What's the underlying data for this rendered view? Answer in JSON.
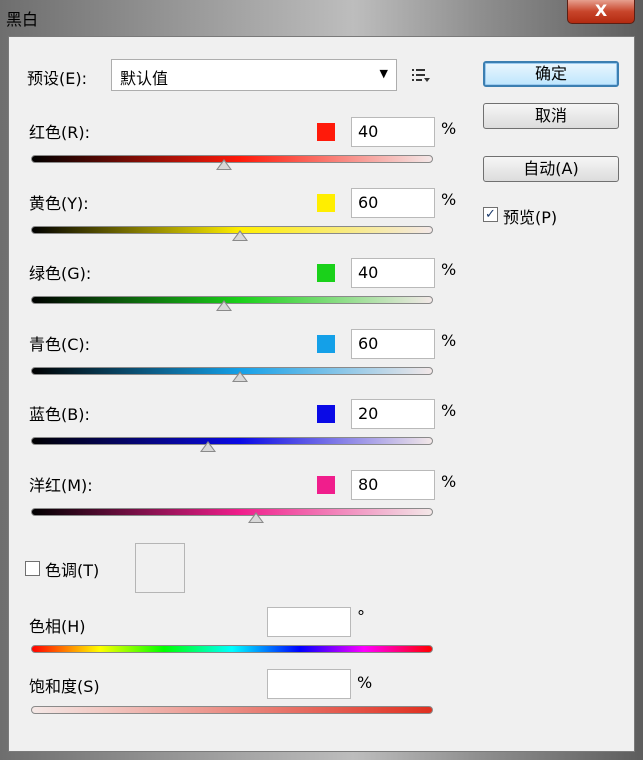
{
  "window": {
    "title": "黑白",
    "close_label": "X"
  },
  "preset": {
    "label": "预设(E):",
    "value": "默认值",
    "arrow": "▼",
    "menu_icon": "list-menu-icon"
  },
  "buttons": {
    "ok": "确定",
    "cancel": "取消",
    "auto": "自动(A)"
  },
  "preview": {
    "label": "预览(P)",
    "checked": true,
    "check_mark": "✓"
  },
  "channels": [
    {
      "label": "红色(R):",
      "value": "40",
      "unit": "%",
      "color": "#ff1a0a",
      "slider_value": 40
    },
    {
      "label": "黄色(Y):",
      "value": "60",
      "unit": "%",
      "color": "#ffee00",
      "slider_value": 60
    },
    {
      "label": "绿色(G):",
      "value": "40",
      "unit": "%",
      "color": "#1ad11a",
      "slider_value": 40
    },
    {
      "label": "青色(C):",
      "value": "60",
      "unit": "%",
      "color": "#14a0e8",
      "slider_value": 60
    },
    {
      "label": "蓝色(B):",
      "value": "20",
      "unit": "%",
      "color": "#0a0ae6",
      "slider_value": 20
    },
    {
      "label": "洋红(M):",
      "value": "80",
      "unit": "%",
      "color": "#f01e8c",
      "slider_value": 80
    }
  ],
  "slider_range": [
    -200,
    300
  ],
  "tint": {
    "label": "色调(T)",
    "checked": false
  },
  "hue": {
    "label": "色相(H)",
    "value": "",
    "unit": "°"
  },
  "saturation": {
    "label": "饱和度(S)",
    "value": "",
    "unit": "%"
  }
}
